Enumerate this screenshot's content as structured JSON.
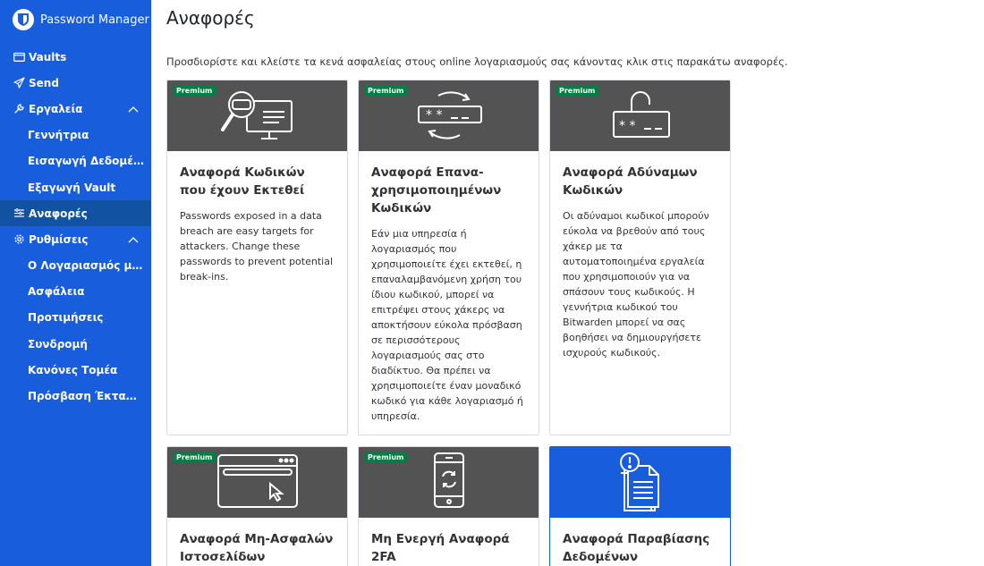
{
  "app": {
    "title": "Password Manager"
  },
  "sidebar": {
    "items": [
      {
        "label": "Vaults",
        "icon": "vault-icon"
      },
      {
        "label": "Send",
        "icon": "send-icon"
      },
      {
        "label": "Εργαλεία",
        "icon": "wrench-icon",
        "expanded": true
      },
      {
        "label": "Γεννήτρια"
      },
      {
        "label": "Εισαγωγή Δεδομένων"
      },
      {
        "label": "Εξαγωγή Vault"
      },
      {
        "label": "Αναφορές",
        "icon": "reports-icon",
        "active": true
      },
      {
        "label": "Ρυθμίσεις",
        "icon": "gear-icon",
        "expanded": true
      },
      {
        "label": "Ο Λογαριασμός μου"
      },
      {
        "label": "Ασφάλεια"
      },
      {
        "label": "Προτιμήσεις"
      },
      {
        "label": "Συνδρομή"
      },
      {
        "label": "Κανόνες Τομέα"
      },
      {
        "label": "Πρόσβαση Έκτακτης ..."
      }
    ]
  },
  "main": {
    "title": "Αναφορές",
    "description": "Προσδιορίστε και κλείστε τα κενά ασφαλείας στους online λογαριασμούς σας κάνοντας κλικ στις παρακάτω αναφορές.",
    "premium_label": "Premium",
    "cards": [
      {
        "title": "Αναφορά Κωδικών που έχουν Εκτεθεί",
        "text": "Passwords exposed in a data breach are easy targets for attackers. Change these passwords to prevent potential break-ins.",
        "premium": true,
        "icon": "exposed-passwords-icon"
      },
      {
        "title": "Αναφορά Επανα-χρησιμοποιημένων Κωδικών",
        "text": "Εάν μια υπηρεσία ή λογαριασμός που χρησιμοποιείτε έχει εκτεθεί, η επαναλαμβανόμενη χρήση του ίδιου κωδικού, μπορεί να επιτρέψει στους χάκερς να αποκτήσουν εύκολα πρόσβαση σε περισσότερους λογαριασμούς σας στο διαδίκτυο. Θα πρέπει να χρησιμοποιείτε έναν μοναδικό κωδικό για κάθε λογαριασμό ή υπηρεσία.",
        "premium": true,
        "icon": "reused-passwords-icon"
      },
      {
        "title": "Αναφορά Αδύναμων Κωδικών",
        "text": "Οι αδύναμοι κωδικοί μπορούν εύκολα να βρεθούν από τους χάκερ με τα αυτοματοποιημένα εργαλεία που χρησιμοποιούν για να σπάσουν τους κωδικούς. Η γεννήτρια κωδικού του Bitwarden μπορεί να σας βοηθήσει να δημιουργήσετε ισχυρούς κωδικούς.",
        "premium": true,
        "icon": "weak-passwords-icon"
      },
      {
        "title": "Αναφορά Μη-Ασφαλών Ιστοσελίδων",
        "text": "",
        "premium": true,
        "icon": "unsecured-websites-icon"
      },
      {
        "title": "Μη Ενεργή Αναφορά 2FA",
        "text": "",
        "premium": true,
        "icon": "inactive-2fa-icon"
      },
      {
        "title": "Αναφορά Παραβίασης Δεδομένων",
        "text": "",
        "premium": false,
        "icon": "data-breach-icon"
      }
    ]
  },
  "colors": {
    "sidebar": "#175ddc",
    "sidebar_active": "#1252a3",
    "card_head": "#535353",
    "premium_badge": "#017e45"
  }
}
